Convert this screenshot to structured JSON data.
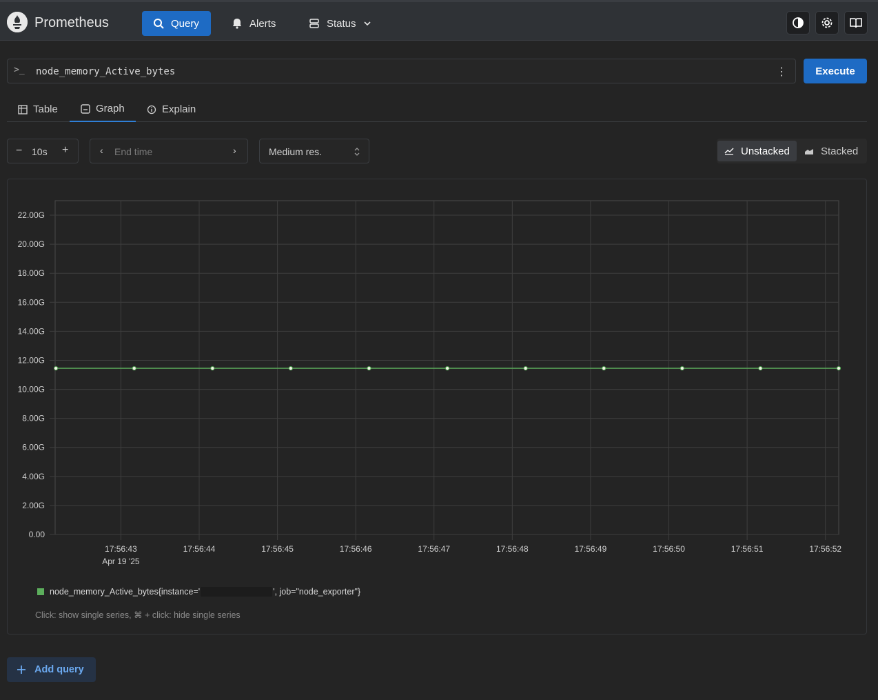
{
  "brand": "Prometheus",
  "nav": {
    "query": "Query",
    "alerts": "Alerts",
    "status": "Status"
  },
  "query": {
    "prompt": ">_",
    "expression": "node_memory_Active_bytes",
    "execute": "Execute"
  },
  "tabs": {
    "table": "Table",
    "graph": "Graph",
    "explain": "Explain"
  },
  "controls": {
    "range": "10s",
    "end_time_placeholder": "End time",
    "resolution": "Medium res.",
    "unstacked": "Unstacked",
    "stacked": "Stacked"
  },
  "chart_data": {
    "type": "line",
    "y_ticks": [
      "0.00",
      "2.00G",
      "4.00G",
      "6.00G",
      "8.00G",
      "10.00G",
      "12.00G",
      "14.00G",
      "16.00G",
      "18.00G",
      "20.00G",
      "22.00G"
    ],
    "y_values": [
      0,
      2,
      4,
      6,
      8,
      10,
      12,
      14,
      16,
      18,
      20,
      22
    ],
    "ylim": [
      0,
      23
    ],
    "x_ticks": [
      "17:56:43",
      "17:56:44",
      "17:56:45",
      "17:56:46",
      "17:56:47",
      "17:56:48",
      "17:56:49",
      "17:56:50",
      "17:56:51",
      "17:56:52"
    ],
    "x_tick_values": [
      43,
      44,
      45,
      46,
      47,
      48,
      49,
      50,
      51,
      52
    ],
    "x_date_label": "Apr 19 '25",
    "xlim": [
      42.16,
      52.17
    ],
    "series": [
      {
        "color": "#5cae5c",
        "x": [
          42.17,
          43.17,
          44.17,
          45.17,
          46.17,
          47.17,
          48.17,
          49.17,
          50.17,
          51.17,
          52.17
        ],
        "y": [
          11.45,
          11.45,
          11.45,
          11.45,
          11.45,
          11.45,
          11.45,
          11.45,
          11.45,
          11.45,
          11.45
        ]
      }
    ]
  },
  "legend": {
    "label_start": "node_memory_Active_bytes{instance='",
    "label_end": "', job=\"node_exporter\"}",
    "hint": "Click: show single series, ⌘ + click: hide single series"
  },
  "add_query": "Add query"
}
